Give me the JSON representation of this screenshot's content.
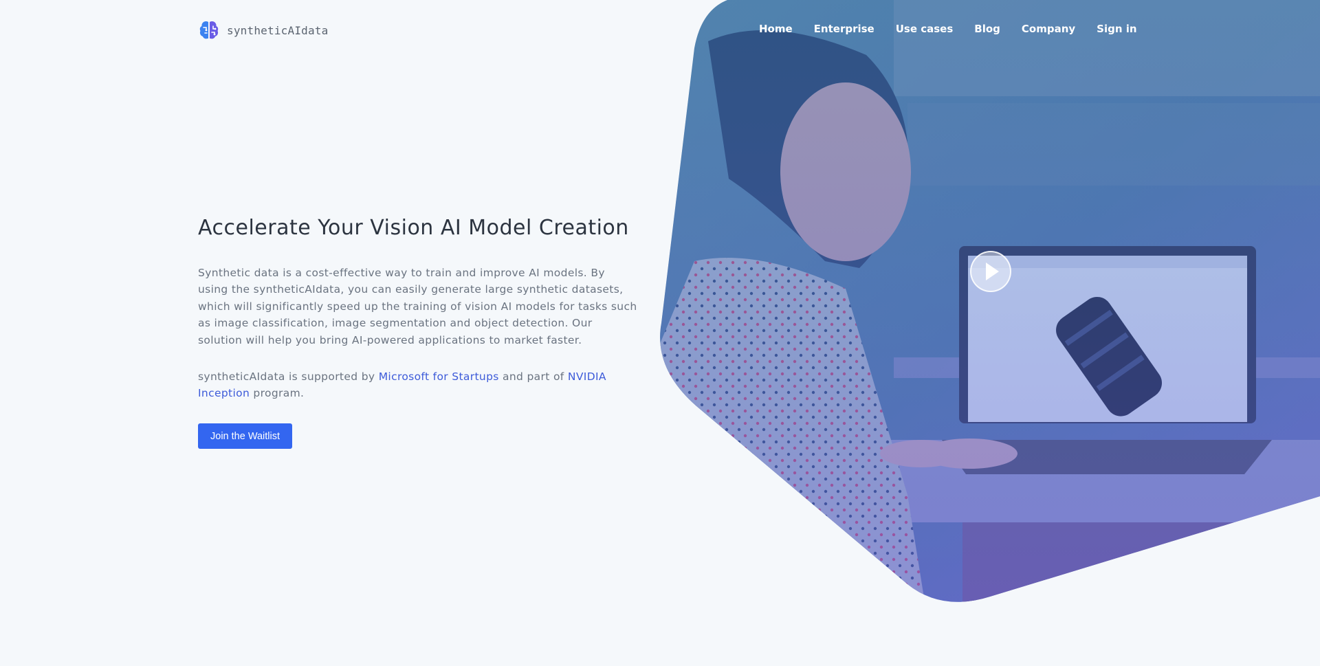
{
  "brand": {
    "name": "syntheticAIdata",
    "logo_icon": "brain-icon",
    "accent_color": "#3366f0"
  },
  "nav": {
    "items": [
      {
        "label": "Home"
      },
      {
        "label": "Enterprise"
      },
      {
        "label": "Use cases"
      },
      {
        "label": "Blog"
      },
      {
        "label": "Company"
      },
      {
        "label": "Sign in"
      }
    ]
  },
  "hero": {
    "headline": "Accelerate Your Vision AI Model Creation",
    "lead": "Synthetic data is a cost-effective way to train and improve AI models. By using the syntheticAIdata, you can easily generate large synthetic datasets, which will significantly speed up the training of vision AI models for tasks such as image classification, image segmentation and object detection. Our solution will help you bring AI-powered applications to market faster.",
    "supported": {
      "prefix": "syntheticAIdata is supported by ",
      "link1": "Microsoft for Startups",
      "middle": " and part of ",
      "link2": "NVIDIA Inception",
      "suffix": " program."
    },
    "cta_label": "Join the Waitlist",
    "video_icon": "play-icon"
  }
}
